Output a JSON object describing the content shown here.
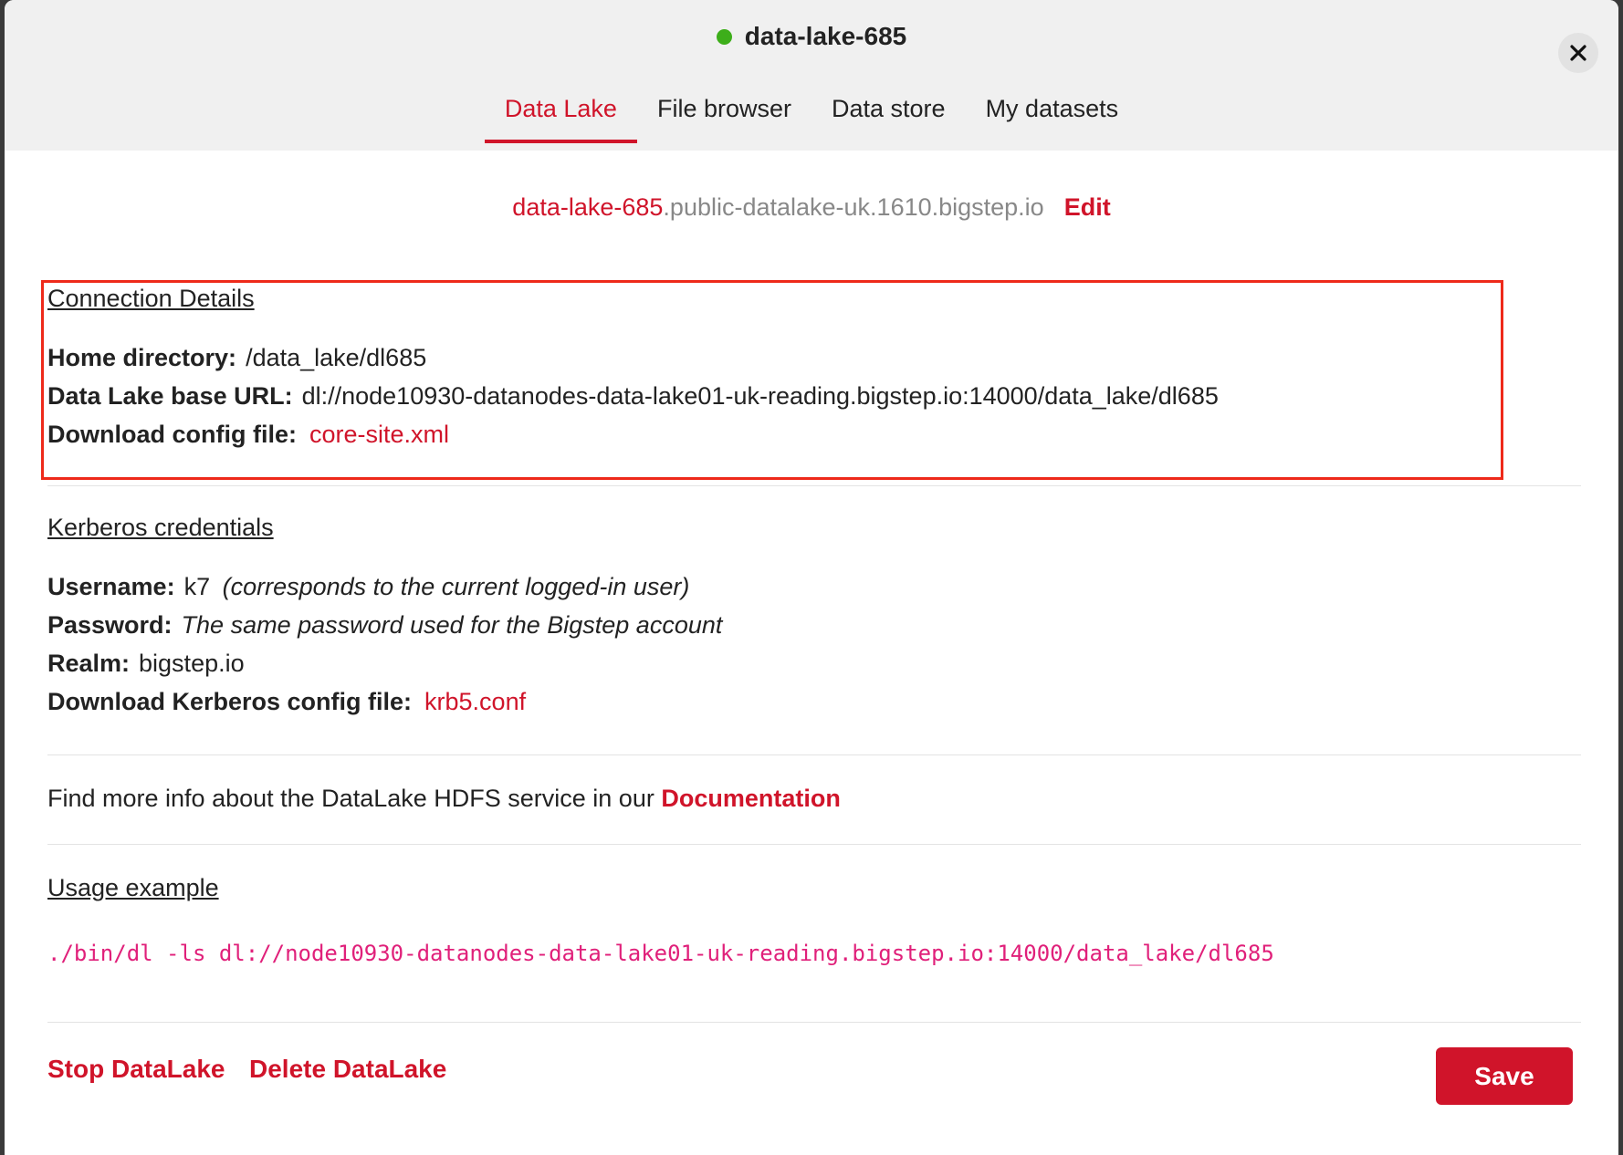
{
  "header": {
    "title": "data-lake-685",
    "status_color": "#3dae1a",
    "close_icon": "close-icon"
  },
  "tabs": [
    {
      "label": "Data Lake",
      "active": true
    },
    {
      "label": "File browser",
      "active": false
    },
    {
      "label": "Data store",
      "active": false
    },
    {
      "label": "My datasets",
      "active": false
    }
  ],
  "host": {
    "name": "data-lake-685",
    "domain": ".public-datalake-uk.1610.bigstep.io",
    "edit_label": "Edit"
  },
  "connection": {
    "title": "Connection Details",
    "home_label": "Home directory:",
    "home_value": "/data_lake/dl685",
    "base_url_label": "Data Lake base URL:",
    "base_url_value": "dl://node10930-datanodes-data-lake01-uk-reading.bigstep.io:14000/data_lake/dl685",
    "config_label": "Download config file:",
    "config_link": "core-site.xml"
  },
  "kerberos": {
    "title": "Kerberos credentials",
    "username_label": "Username:",
    "username_value": "k7",
    "username_note": "(corresponds to the current logged-in user)",
    "password_label": "Password:",
    "password_value": "The same password used for the Bigstep account",
    "realm_label": "Realm:",
    "realm_value": "bigstep.io",
    "config_label": "Download Kerberos config file:",
    "config_link": "krb5.conf"
  },
  "info": {
    "text": "Find more info about the DataLake HDFS service in our",
    "link": "Documentation"
  },
  "usage": {
    "title": "Usage example",
    "code": "./bin/dl -ls dl://node10930-datanodes-data-lake01-uk-reading.bigstep.io:14000/data_lake/dl685"
  },
  "footer": {
    "stop_label": "Stop DataLake",
    "delete_label": "Delete DataLake",
    "save_label": "Save"
  },
  "colors": {
    "accent": "#d0142a",
    "highlight_border": "#ee2a1a",
    "code": "#e0207a"
  }
}
